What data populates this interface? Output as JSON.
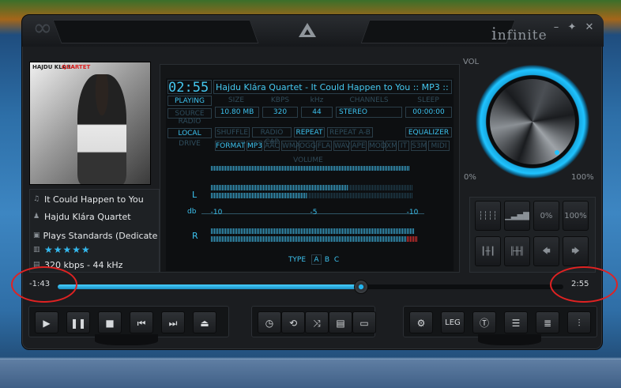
{
  "window": {
    "brand_prefix": "i",
    "brand": "nfinite",
    "minimize": "–",
    "pin": "✦",
    "close": "✕"
  },
  "album_art": {
    "top_caption": "HAJDU KLÁRA",
    "top_caption_red": "QUARTET"
  },
  "track": {
    "title": "It Could Happen to You",
    "artist": "Hajdu Klára Quartet",
    "album": "Plays Standards (Dedicate...",
    "rating": "★★★★★",
    "bitrate_line": "320 kbps - 44 kHz"
  },
  "display": {
    "clock": "02:55",
    "marquee": "Hajdu Klára Quartet - It Could Happen to You :: MP3 ::",
    "status": "PLAYING",
    "source": "SOURCE",
    "radio": "RADIO",
    "local": "LOCAL",
    "drive": "DRIVE",
    "size_label": "SIZE",
    "size_value": "10.80 MB",
    "kbps_label": "KBPS",
    "kbps_value": "320",
    "khz_label": "kHz",
    "khz_value": "44",
    "channels_label": "CHANNELS",
    "channels_value": "STEREO",
    "sleep_label": "SLEEP",
    "sleep_value": "00:00:00",
    "shuffle": "SHUFFLE",
    "radio_cap": "RADIO CAP",
    "repeat": "REPEAT",
    "repeat_ab": "REPEAT A-B",
    "equalizer": "EQUALIZER",
    "formats": [
      "FORMAT",
      "MP3",
      "AAC",
      "WMA",
      "OGG",
      "FLA",
      "WAV",
      "APE",
      "MOD",
      "XM",
      "IT",
      "S3M",
      "MIDI"
    ],
    "volume_label": "VOLUME",
    "left_channel": "L",
    "db_label": "db",
    "right_channel": "R",
    "scale_minus": "-10",
    "scale_mid": "-5",
    "scale_plus": "-10",
    "type_label": "TYPE",
    "type_a": "A",
    "type_b": "B",
    "type_c": "C"
  },
  "volume_knob": {
    "label": "VOL",
    "min": "0%",
    "max": "100%"
  },
  "grid_buttons": {
    "zero": "0%",
    "hundred": "100%",
    "left": "🡄",
    "right": "🡆"
  },
  "seek": {
    "elapsed": "-1:43",
    "total": "2:55",
    "progress": 0.6
  },
  "controls": {
    "leg_label": "LEG"
  },
  "colors": {
    "accent": "#3cc2ef",
    "annotation": "#e02222"
  }
}
